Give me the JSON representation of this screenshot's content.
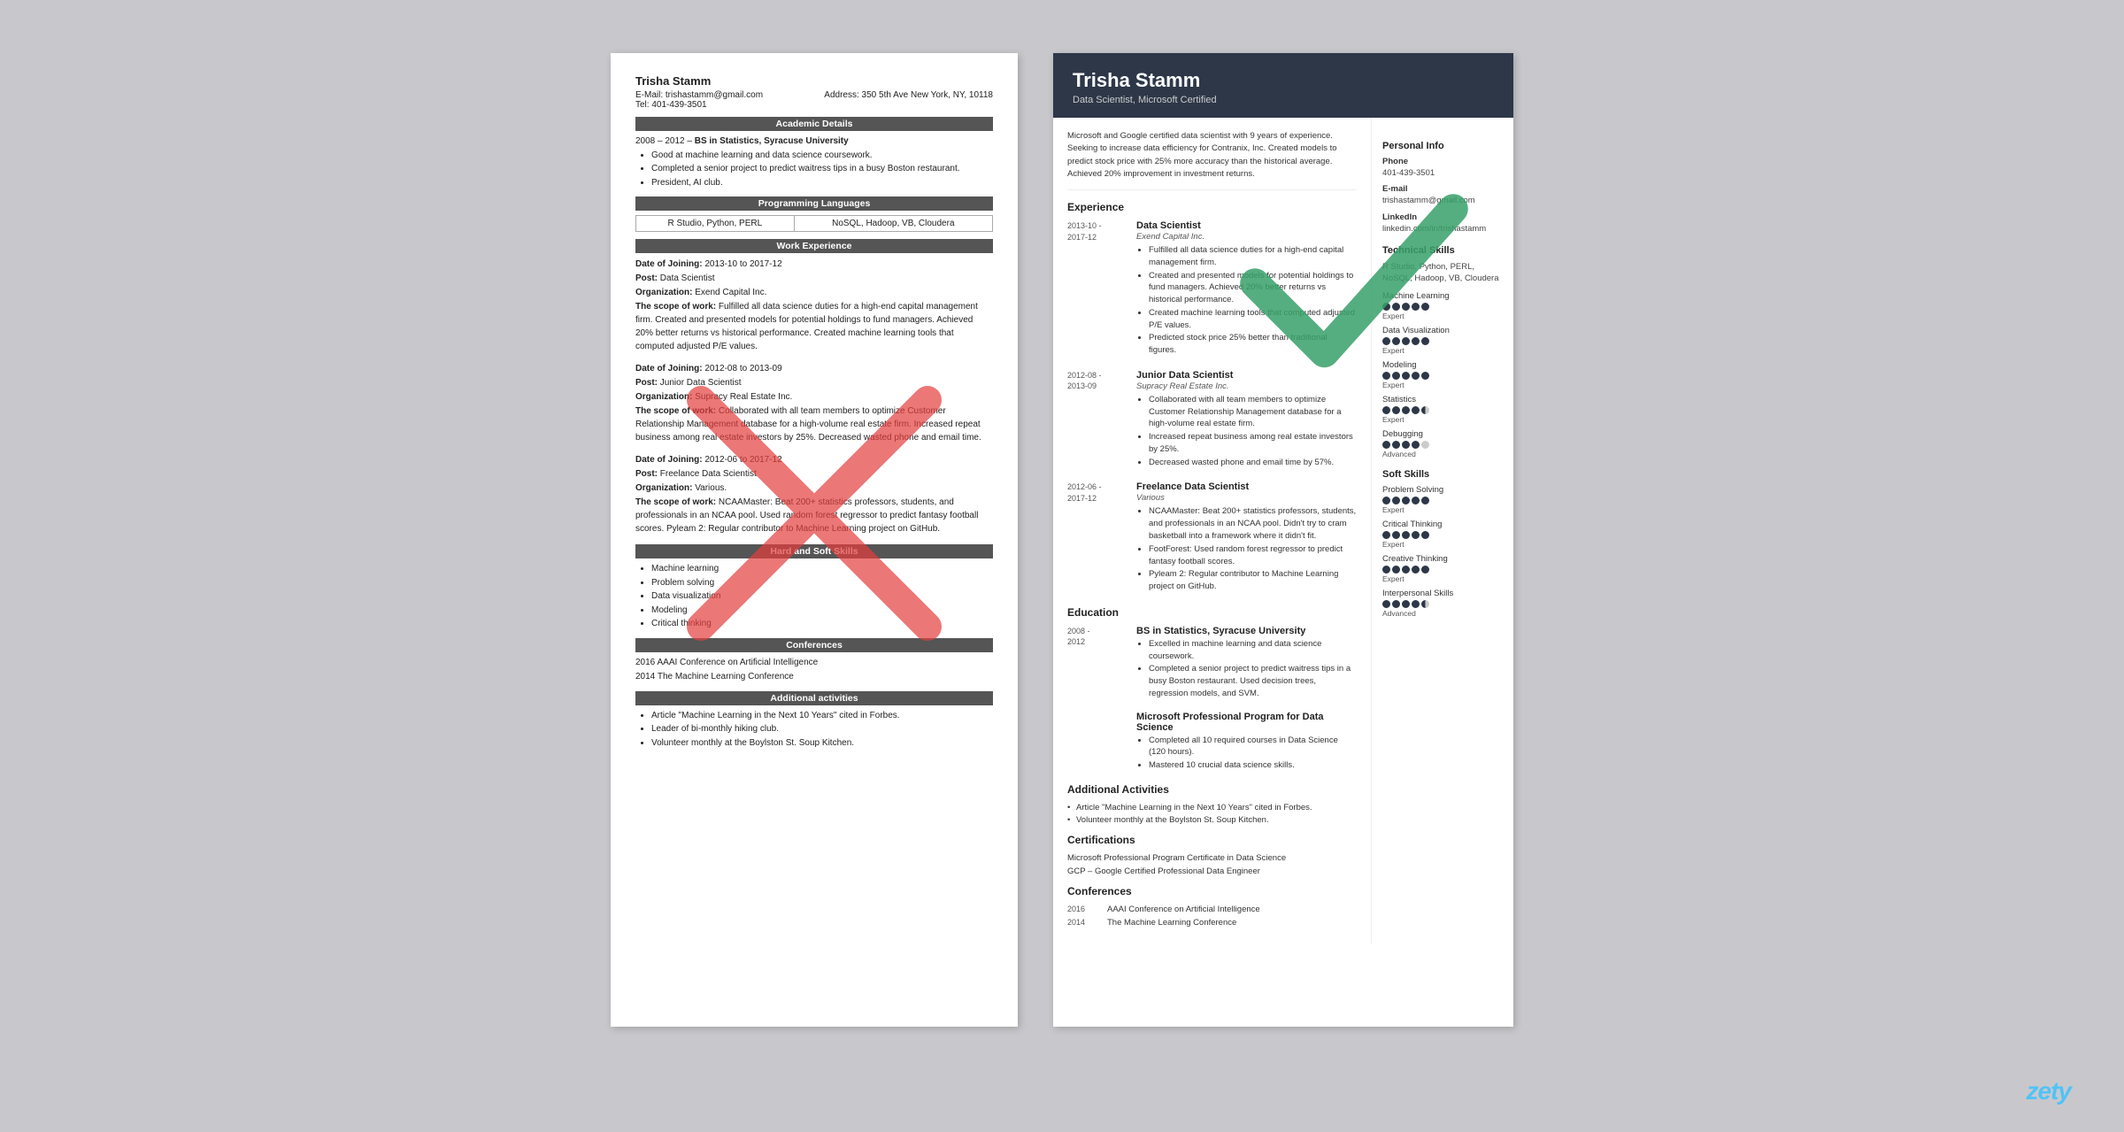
{
  "left_resume": {
    "name": "Trisha Stamm",
    "email_label": "E-Mail:",
    "email": "trishastamm@gmail.com",
    "address_label": "Address:",
    "address": "350 5th Ave New York, NY, 10118",
    "tel_label": "Tel:",
    "tel": "401-439-3501",
    "sections": {
      "academic": "Academic Details",
      "programming": "Programming Languages",
      "work": "Work Experience",
      "skills": "Hard and Soft Skills",
      "conferences": "Conferences",
      "additional": "Additional activities"
    },
    "academic": {
      "years": "2008 – 2012 –",
      "degree": "BS in Statistics, Syracuse University",
      "bullets": [
        "Good at machine learning and data science coursework.",
        "Completed a senior project to predict waitress tips in a busy Boston restaurant.",
        "President, AI club."
      ]
    },
    "programming": {
      "left": "R Studio, Python, PERL",
      "right": "NoSQL, Hadoop, VB, Cloudera"
    },
    "work_entries": [
      {
        "date_label": "Date of Joining:",
        "date": "2013-10 to 2017-12",
        "post_label": "Post:",
        "post": "Data Scientist",
        "org_label": "Organization:",
        "org": "Exend Capital Inc.",
        "scope_label": "The scope of work:",
        "scope": "Fulfilled all data science duties for a high-end capital management firm. Created and presented models for potential holdings to fund managers. Achieved 20% better returns vs historical performance. Created machine learning tools that computed adjusted P/E values."
      },
      {
        "date_label": "Date of Joining:",
        "date": "2012-08 to 2013-09",
        "post_label": "Post:",
        "post": "Junior Data Scientist",
        "org_label": "Organization:",
        "org": "Supracy Real Estate Inc.",
        "scope_label": "The scope of work:",
        "scope": "Collaborated with all team members to optimize Customer Relationship Management database for a high-volume real estate firm. Increased repeat business among real estate investors by 25%. Decreased wasted phone and email time."
      },
      {
        "date_label": "Date of Joining:",
        "date": "2012-06 to 2017-12",
        "post_label": "Post:",
        "post": "Freelance Data Scientist",
        "org_label": "Organization:",
        "org": "Various.",
        "scope_label": "The scope of work:",
        "scope": "NCAAMaster: Beat 200+ statistics professors, students, and professionals in an NCAA pool. Used random forest regressor to predict fantasy football scores. Pyleam 2: Regular contributor to Machine Learning project on GitHub."
      }
    ],
    "skills": [
      "Machine learning",
      "Problem solving",
      "Data visualization",
      "Modeling",
      "Critical thinking"
    ],
    "conferences": [
      "2016 AAAI Conference on Artificial Intelligence",
      "2014 The Machine Learning Conference"
    ],
    "additional_bullets": [
      "Article \"Machine Learning in the Next 10 Years\" cited in Forbes.",
      "Leader of bi-monthly hiking club.",
      "Volunteer monthly at the Boylston St. Soup Kitchen."
    ]
  },
  "right_resume": {
    "name": "Trisha Stamm",
    "title": "Data Scientist, Microsoft Certified",
    "summary": "Microsoft and Google certified data scientist with 9 years of experience. Seeking to increase data efficiency for Contranix, Inc. Created models to predict stock price with 25% more accuracy than the historical average. Achieved 20% improvement in investment returns.",
    "sections": {
      "experience": "Experience",
      "education": "Education",
      "additional": "Additional Activities",
      "certifications": "Certifications",
      "conferences": "Conferences"
    },
    "experience": [
      {
        "date": "2013-10 -\n2017-12",
        "title": "Data Scientist",
        "company": "Exend Capital Inc.",
        "bullets": [
          "Fulfilled all data science duties for a high-end capital management firm.",
          "Created and presented models for potential holdings to fund managers. Achieved 20% better returns vs historical performance.",
          "Created machine learning tools that computed adjusted P/E values.",
          "Predicted stock price 25% better than traditional figures."
        ]
      },
      {
        "date": "2012-08 -\n2013-09",
        "title": "Junior Data Scientist",
        "company": "Supracy Real Estate Inc.",
        "bullets": [
          "Collaborated with all team members to optimize Customer Relationship Management database for a high-volume real estate firm.",
          "Increased repeat business among real estate investors by 25%.",
          "Decreased wasted phone and email time by 57%."
        ]
      },
      {
        "date": "2012-06 -\n2017-12",
        "title": "Freelance Data Scientist",
        "company": "Various",
        "bullets": [
          "NCAAMaster: Beat 200+ statistics professors, students, and professionals in an NCAA pool. Didn't try to cram basketball into a framework where it didn't fit.",
          "FootForest: Used random forest regressor to predict fantasy football scores.",
          "Pyleam 2: Regular contributor to Machine Learning project on GitHub."
        ]
      }
    ],
    "education": [
      {
        "date": "2008 -\n2012",
        "title": "BS in Statistics, Syracuse University",
        "bullets": [
          "Excelled in machine learning and data science coursework.",
          "Completed a senior project to predict waitress tips in a busy Boston restaurant. Used decision trees, regression models, and SVM."
        ]
      },
      {
        "date": "",
        "title": "Microsoft Professional Program for Data Science",
        "bullets": [
          "Completed all 10 required courses in Data Science (120 hours).",
          "Mastered 10 crucial data science skills."
        ]
      }
    ],
    "additional_activities": [
      "Article \"Machine Learning in the Next 10 Years\" cited in Forbes.",
      "Volunteer monthly at the Boylston St. Soup Kitchen."
    ],
    "certifications": [
      "Microsoft Professional Program Certificate in Data Science",
      "GCP – Google Certified Professional Data Engineer"
    ],
    "conferences": [
      {
        "year": "2016",
        "name": "AAAI Conference on Artificial Intelligence"
      },
      {
        "year": "2014",
        "name": "The Machine Learning Conference"
      }
    ],
    "sidebar": {
      "personal_info_title": "Personal Info",
      "phone_label": "Phone",
      "phone": "401-439-3501",
      "email_label": "E-mail",
      "email": "trishastamm@gmail.com",
      "linkedin_label": "LinkedIn",
      "linkedin": "linkedin.com/in/trishastamm",
      "tech_skills_title": "Technical Skills",
      "tech_skills_intro": "R Studio, Python, PERL, NoSQL, Hadoop, VB, Cloudera",
      "tech_skills": [
        {
          "name": "Machine Learning",
          "dots": 5,
          "half": false,
          "level": "Expert"
        },
        {
          "name": "Data Visualization",
          "dots": 5,
          "half": false,
          "level": "Expert"
        },
        {
          "name": "Modeling",
          "dots": 5,
          "half": false,
          "level": "Expert"
        },
        {
          "name": "Statistics",
          "dots": 4,
          "half": true,
          "level": "Expert"
        },
        {
          "name": "Debugging",
          "dots": 4,
          "half": false,
          "level": "Advanced"
        }
      ],
      "soft_skills_title": "Soft Skills",
      "soft_skills": [
        {
          "name": "Problem Solving",
          "dots": 5,
          "half": false,
          "level": "Expert"
        },
        {
          "name": "Critical Thinking",
          "dots": 5,
          "half": false,
          "level": "Expert"
        },
        {
          "name": "Creative Thinking",
          "dots": 5,
          "half": false,
          "level": "Expert"
        },
        {
          "name": "Interpersonal Skills",
          "dots": 4,
          "half": true,
          "level": "Advanced"
        }
      ]
    }
  },
  "watermark": "zety"
}
